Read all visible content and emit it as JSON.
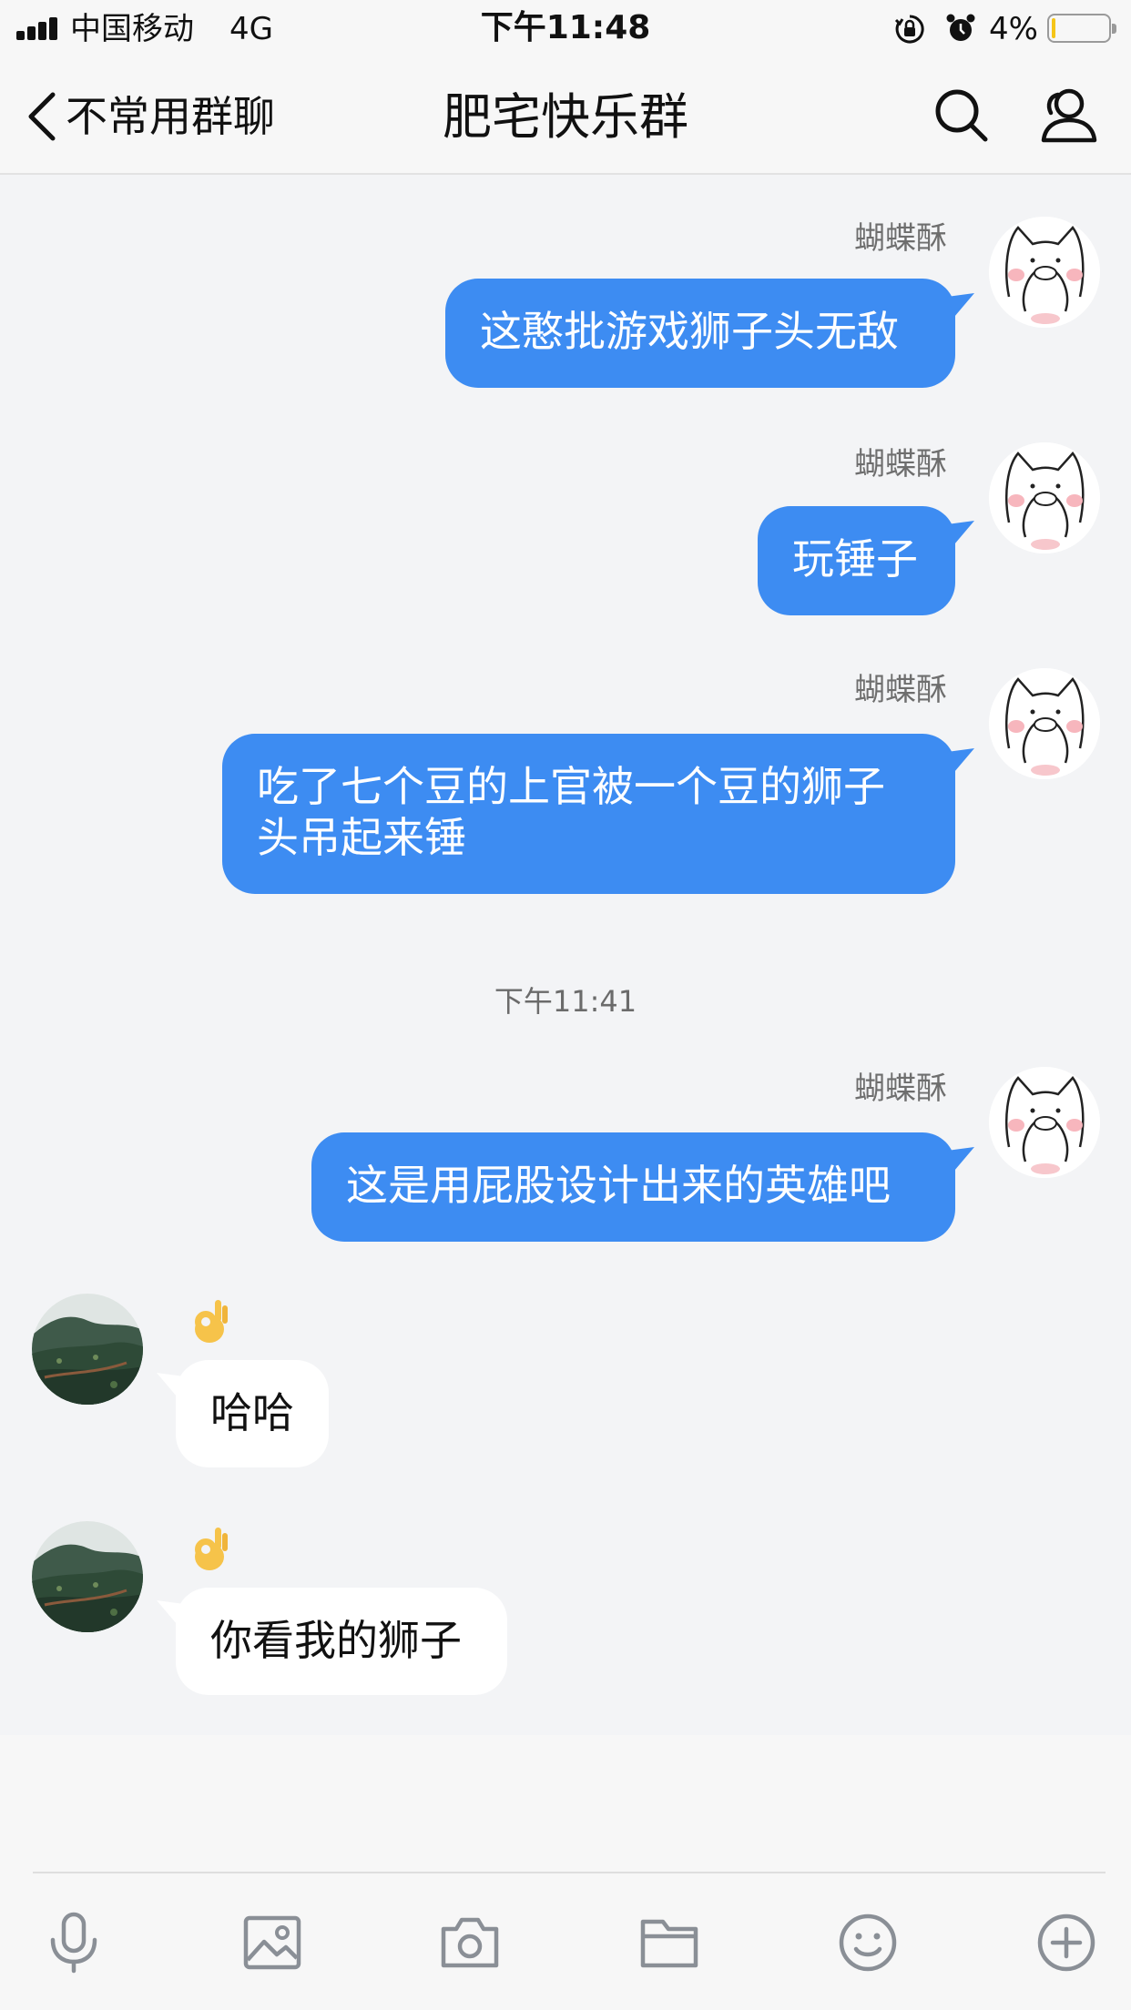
{
  "status_bar": {
    "carrier": "中国移动",
    "network": "4G",
    "time": "下午11:48",
    "battery_percent": "4%",
    "battery_level": 0.04
  },
  "nav": {
    "back_label": "不常用群聊",
    "title": "肥宅快乐群"
  },
  "messages": {
    "m1": {
      "sender": "蝴蝶酥",
      "text": "这憨批游戏狮子头无敌"
    },
    "m2": {
      "sender": "蝴蝶酥",
      "text": "玩锤子"
    },
    "m3": {
      "sender": "蝴蝶酥",
      "text": "吃了七个豆的上官被一个豆的狮子头吊起来锤"
    },
    "time_divider": "下午11:41",
    "m4": {
      "sender": "蝴蝶酥",
      "text": "这是用屁股设计出来的英雄吧"
    },
    "m5": {
      "reaction": "ok-hand-emoji",
      "text": "哈哈"
    },
    "m6": {
      "reaction": "ok-hand-emoji",
      "text": "你看我的狮子"
    }
  },
  "colors": {
    "outgoing_bubble": "#3d8cf2",
    "incoming_bubble": "#ffffff",
    "chat_background": "#f3f4f6",
    "icon_gray": "#8a8f96"
  },
  "toolbar": {
    "icons": [
      "microphone-icon",
      "image-icon",
      "camera-icon",
      "folder-icon",
      "emoji-icon",
      "plus-icon"
    ]
  }
}
